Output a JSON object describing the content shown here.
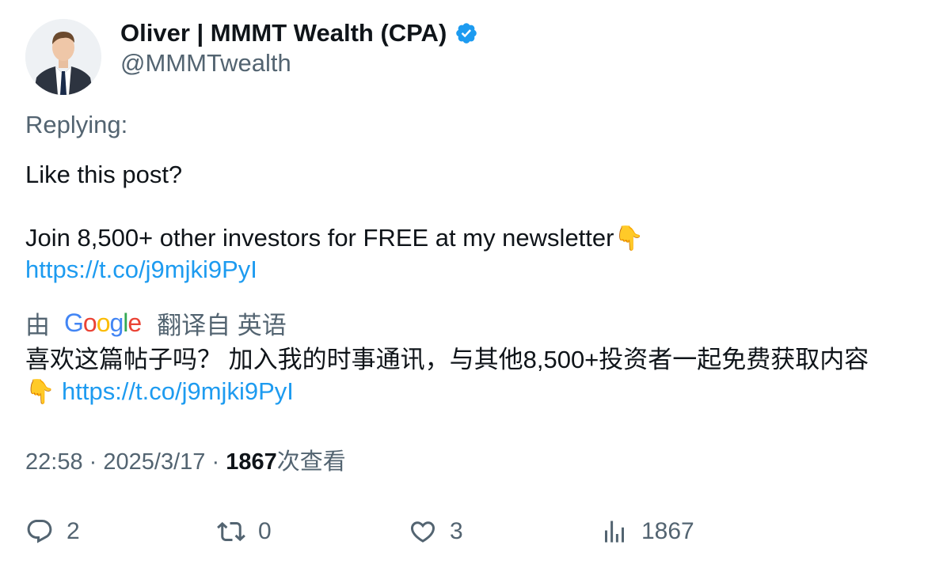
{
  "author": {
    "display_name": "Oliver | MMMT Wealth (CPA)",
    "handle": "@MMMTwealth",
    "verified": true,
    "verified_color": "#1d9bf0"
  },
  "replying_label": "Replying:",
  "tweet": {
    "line1": "Like this post?",
    "line2": "Join 8,500+ other investors for FREE at my newsletter",
    "line2_emoji": "👇",
    "link": "https://t.co/j9mjki9PyI"
  },
  "translation": {
    "prefix": "由",
    "provider": "Google",
    "suffix": "翻译自 英语",
    "text": "喜欢这篇帖子吗？ 加入我的时事通讯，与其他8,500+投资者一起免费获取内容",
    "emoji": "👇",
    "link": "https://t.co/j9mjki9PyI"
  },
  "meta": {
    "time": "22:58",
    "separator": "·",
    "date": "2025/3/17",
    "views_count": "1867",
    "views_label": "次查看"
  },
  "actions": {
    "replies": "2",
    "reposts": "0",
    "likes": "3",
    "views": "1867"
  },
  "colors": {
    "text": "#0f1419",
    "secondary": "#536471",
    "link": "#1d9bf0"
  },
  "icons": {
    "reply": "reply-icon",
    "repost": "repost-icon",
    "like": "heart-icon",
    "views": "views-icon",
    "verified": "verified-badge-icon",
    "pointing": "backhand-index-pointing-down-emoji"
  }
}
